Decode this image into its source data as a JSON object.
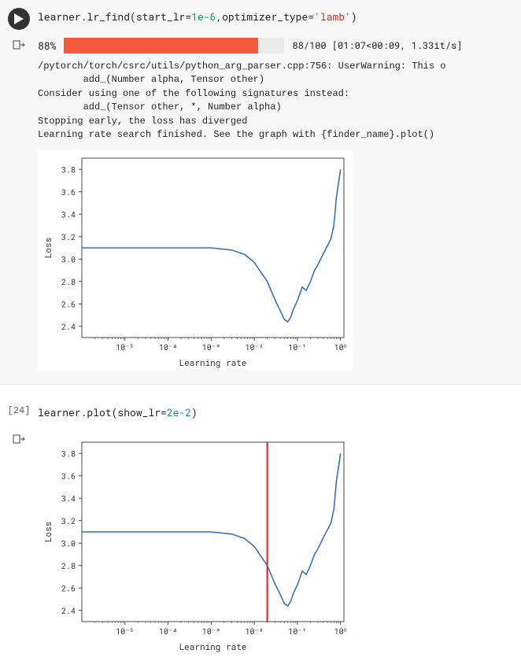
{
  "cell1": {
    "code_parts": {
      "prefix": "learner.lr_find(start_lr=",
      "num": "1e-6",
      "mid": ",optimizer_type=",
      "str": "'lamb'",
      "suffix": ")"
    },
    "progress": {
      "pct": "88%",
      "fill_pct": 88,
      "text": "88/100 [01:07<00:09, 1.33it/s]"
    },
    "output_lines": [
      "/pytorch/torch/csrc/utils/python_arg_parser.cpp:756: UserWarning: This o",
      "        add_(Number alpha, Tensor other)",
      "Consider using one of the following signatures instead:",
      "        add_(Tensor other, *, Number alpha)",
      "Stopping early, the loss has diverged",
      "Learning rate search finished. See the graph with {finder_name}.plot()"
    ]
  },
  "cell2": {
    "num": "[24]",
    "code_parts": {
      "prefix": "learner.plot(show_lr=",
      "num": "2e-2",
      "suffix": ")"
    }
  },
  "chart_data": {
    "type": "line",
    "title": "",
    "xlabel": "Learning rate",
    "ylabel": "Loss",
    "xscale": "log",
    "xlim": [
      1e-06,
      1.2
    ],
    "ylim": [
      2.3,
      3.9
    ],
    "xticks": [
      1e-05,
      0.0001,
      0.001,
      0.01,
      0.1,
      1
    ],
    "xticklabels": [
      "10⁻⁵",
      "10⁻⁴",
      "10⁻³",
      "10⁻²",
      "10⁻¹",
      "10⁰"
    ],
    "yticks": [
      2.4,
      2.6,
      2.8,
      3.0,
      3.2,
      3.4,
      3.6,
      3.8
    ],
    "series": [
      {
        "name": "loss",
        "x": [
          1e-06,
          3e-06,
          1e-05,
          3e-05,
          0.0001,
          0.0003,
          0.001,
          0.003,
          0.006,
          0.01,
          0.02,
          0.03,
          0.04,
          0.05,
          0.06,
          0.07,
          0.08,
          0.1,
          0.13,
          0.16,
          0.2,
          0.25,
          0.3,
          0.4,
          0.5,
          0.6,
          0.7,
          0.8,
          1.0
        ],
        "values": [
          3.1,
          3.1,
          3.1,
          3.1,
          3.1,
          3.1,
          3.1,
          3.08,
          3.04,
          2.97,
          2.8,
          2.64,
          2.54,
          2.46,
          2.44,
          2.48,
          2.55,
          2.63,
          2.75,
          2.72,
          2.8,
          2.9,
          2.95,
          3.05,
          3.12,
          3.18,
          3.3,
          3.55,
          3.8
        ]
      }
    ],
    "vline": 0.02
  }
}
